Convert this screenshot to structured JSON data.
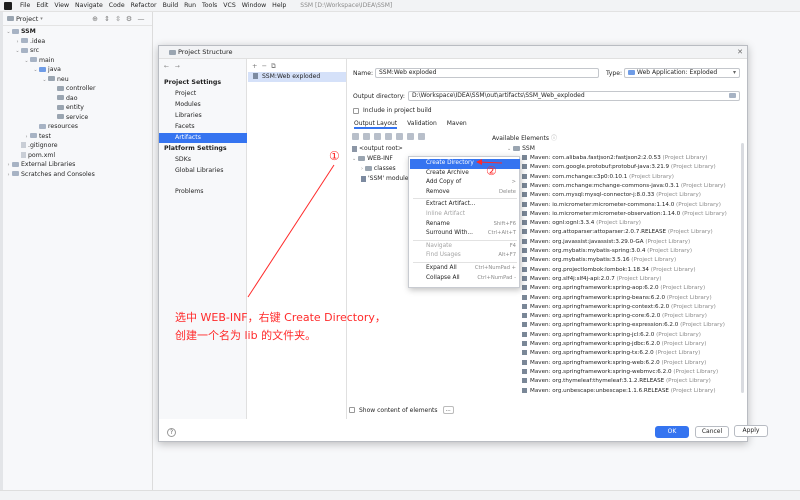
{
  "menu": {
    "items": [
      "File",
      "Edit",
      "View",
      "Navigate",
      "Code",
      "Refactor",
      "Build",
      "Run",
      "Tools",
      "VCS",
      "Window",
      "Help"
    ],
    "window_title": "SSM [D:\\Workspace\\IDEA\\SSM]"
  },
  "project_tool": {
    "title": "Project",
    "tree": [
      {
        "label": "SSM",
        "depth": 0,
        "bold": true,
        "icon": "module"
      },
      {
        "label": ".idea",
        "depth": 1,
        "icon": "folder"
      },
      {
        "label": "src",
        "depth": 1,
        "icon": "folder"
      },
      {
        "label": "main",
        "depth": 2,
        "icon": "folder"
      },
      {
        "label": "java",
        "depth": 3,
        "icon": "source-folder"
      },
      {
        "label": "neu",
        "depth": 4,
        "icon": "package"
      },
      {
        "label": "controller",
        "depth": 5,
        "icon": "package"
      },
      {
        "label": "dao",
        "depth": 5,
        "icon": "package"
      },
      {
        "label": "entity",
        "depth": 5,
        "icon": "package"
      },
      {
        "label": "service",
        "depth": 5,
        "icon": "package"
      },
      {
        "label": "resources",
        "depth": 3,
        "icon": "folder"
      },
      {
        "label": "test",
        "depth": 2,
        "icon": "folder"
      },
      {
        "label": ".gitignore",
        "depth": 1,
        "icon": "file"
      },
      {
        "label": "pom.xml",
        "depth": 1,
        "icon": "file"
      },
      {
        "label": "External Libraries",
        "depth": 0,
        "icon": "library"
      },
      {
        "label": "Scratches and Consoles",
        "depth": 0,
        "icon": "scratch"
      }
    ]
  },
  "dialog": {
    "title": "Project Structure",
    "nav": {
      "project_settings_header": "Project Settings",
      "project_settings": [
        "Project",
        "Modules",
        "Libraries",
        "Facets",
        "Artifacts"
      ],
      "platform_settings_header": "Platform Settings",
      "platform_settings": [
        "SDKs",
        "Global Libraries"
      ],
      "problems": "Problems"
    },
    "artifact_item": "SSM:Web exploded",
    "name_label": "Name:",
    "name_value": "SSM:Web exploded",
    "type_label": "Type:",
    "type_value": "Web Application: Exploded",
    "output_dir_label": "Output directory:",
    "output_dir_value": "D:\\Workspace\\IDEA\\SSM\\out\\artifacts\\SSM_Web_exploded",
    "include_in_build": "Include in project build",
    "tabs": [
      "Output Layout",
      "Validation",
      "Maven"
    ],
    "available_elements": "Available Elements",
    "output_tree": {
      "root": "<output root>",
      "webinf": "WEB-INF",
      "classes": "classes",
      "ssm_module": "'SSM' module"
    },
    "available_root": "SSM",
    "libraries": [
      "com.alibaba.fastjson2:fastjson2:2.0.53",
      "com.google.protobuf:protobuf-java:3.21.9",
      "com.mchange:c3p0:0.10.1",
      "com.mchange:mchange-commons-java:0.3.1",
      "com.mysql:mysql-connector-j:8.0.33",
      "io.micrometer:micrometer-commons:1.14.0",
      "io.micrometer:micrometer-observation:1.14.0",
      "ognl:ognl:3.3.4",
      "org.attoparser:attoparser:2.0.7.RELEASE",
      "org.javassist:javassist:3.29.0-GA",
      "org.mybatis:mybatis-spring:3.0.4",
      "org.mybatis:mybatis:3.5.16",
      "org.projectlombok:lombok:1.18.34",
      "org.slf4j:slf4j-api:2.0.7",
      "org.springframework:spring-aop:6.2.0",
      "org.springframework:spring-beans:6.2.0",
      "org.springframework:spring-context:6.2.0",
      "org.springframework:spring-core:6.2.0",
      "org.springframework:spring-expression:6.2.0",
      "org.springframework:spring-jcl:6.2.0",
      "org.springframework:spring-jdbc:6.2.0",
      "org.springframework:spring-tx:6.2.0",
      "org.springframework:spring-web:6.2.0",
      "org.springframework:spring-webmvc:6.2.0",
      "org.thymeleaf:thymeleaf:3.1.2.RELEASE",
      "org.unbescape:unbescape:1.1.6.RELEASE"
    ],
    "library_prefix": "Maven: ",
    "library_suffix": " (Project Library)",
    "show_content": "Show content of elements",
    "show_content_btn": "...",
    "buttons": {
      "ok": "OK",
      "cancel": "Cancel",
      "apply": "Apply"
    },
    "help": "?"
  },
  "context_menu": [
    {
      "label": "Create Directory",
      "shortcut": "",
      "state": "highlighted"
    },
    {
      "label": "Create Archive",
      "shortcut": "",
      "state": "normal"
    },
    {
      "label": "Add Copy of",
      "shortcut": ">",
      "state": "normal"
    },
    {
      "label": "Remove",
      "shortcut": "Delete",
      "state": "normal"
    },
    {
      "label": "Extract Artifact...",
      "shortcut": "",
      "state": "normal"
    },
    {
      "label": "Inline Artifact",
      "shortcut": "",
      "state": "disabled"
    },
    {
      "label": "Rename",
      "shortcut": "Shift+F6",
      "state": "normal"
    },
    {
      "label": "Surround With...",
      "shortcut": "Ctrl+Alt+T",
      "state": "normal"
    },
    {
      "label": "Navigate",
      "shortcut": "F4",
      "state": "disabled"
    },
    {
      "label": "Find Usages",
      "shortcut": "Alt+F7",
      "state": "disabled"
    },
    {
      "label": "Expand All",
      "shortcut": "Ctrl+NumPad +",
      "state": "normal"
    },
    {
      "label": "Collapse All",
      "shortcut": "Ctrl+NumPad -",
      "state": "normal"
    }
  ],
  "annotation": {
    "marker1": "①",
    "marker2": "②",
    "line1": "选中 WEB-INF，右键 Create Directory，",
    "line2": "创建一个名为 lib 的文件夹。",
    "color": "#ff2a2a"
  },
  "colors": {
    "accent": "#3574f0",
    "selection": "#d5e1f9"
  }
}
